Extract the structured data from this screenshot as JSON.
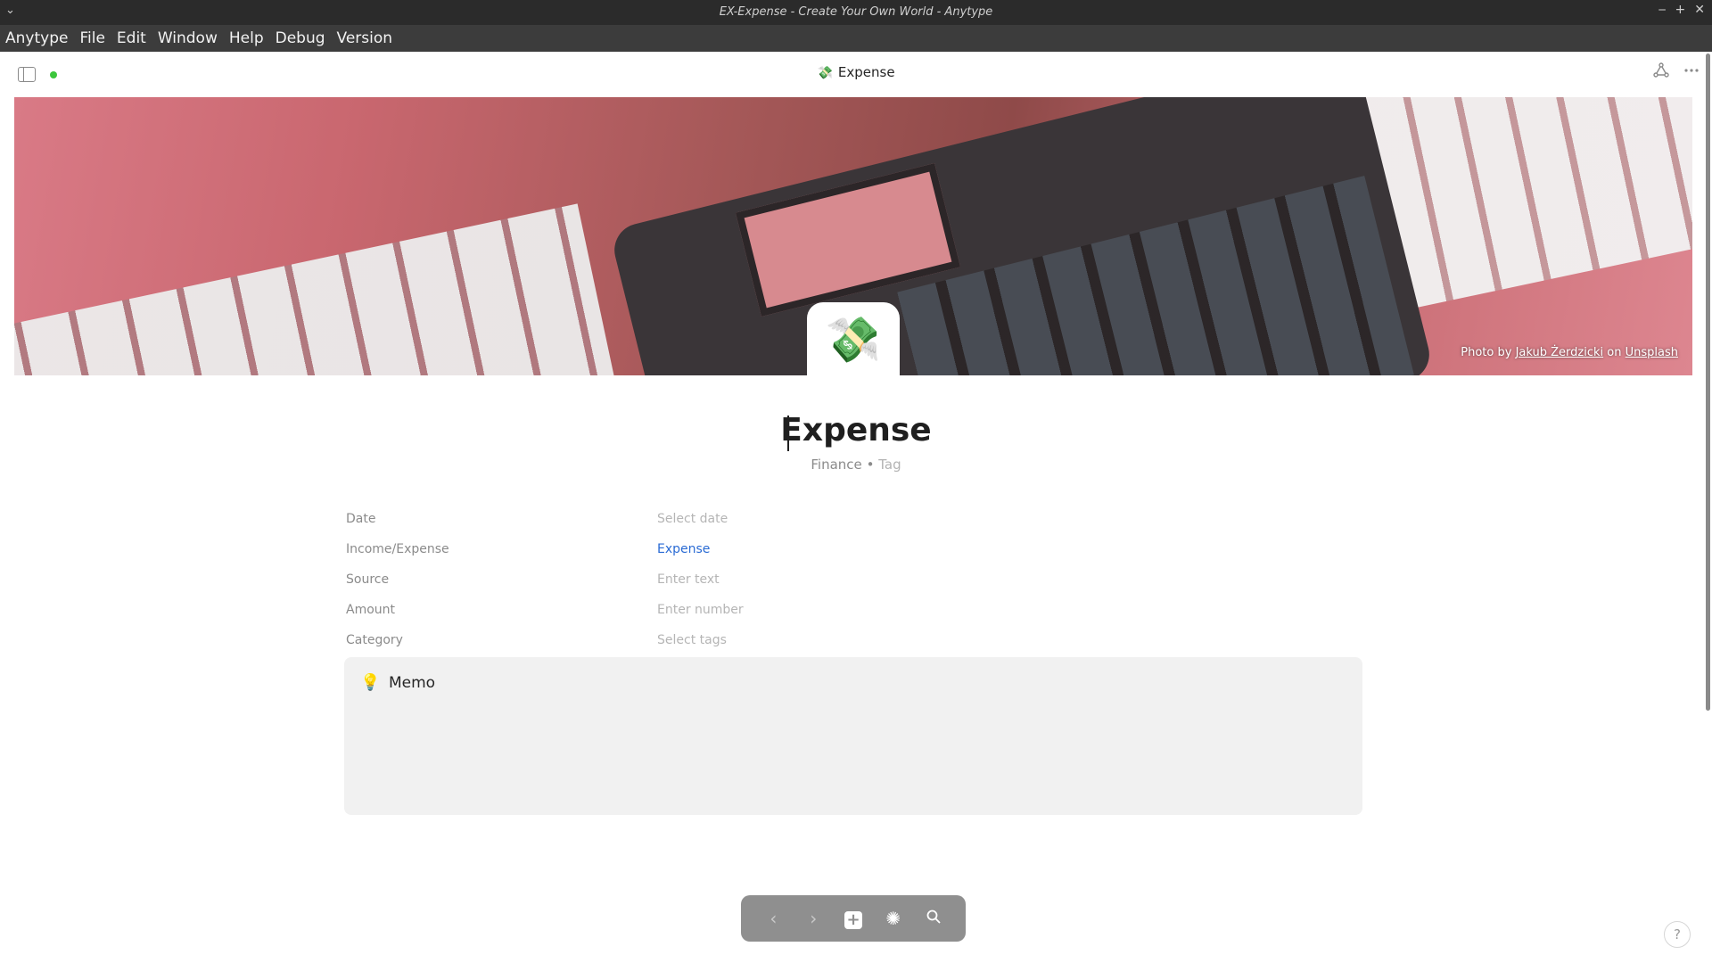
{
  "window": {
    "title": "EX-Expense - Create Your Own World - Anytype",
    "left_glyph": "⌄",
    "controls": [
      "‒",
      "+",
      "✕"
    ]
  },
  "menubar": {
    "items": [
      "Anytype",
      "File",
      "Edit",
      "Window",
      "Help",
      "Debug",
      "Version"
    ]
  },
  "header": {
    "title": "Expense",
    "title_emoji": "💸",
    "sync_color": "#3cc63c",
    "right_icons": [
      "share-graph-icon",
      "more-icon"
    ]
  },
  "cover": {
    "credit_prefix": "Photo by",
    "credit_author": "Jakub Żerdzicki",
    "credit_on": "on",
    "credit_site": "Unsplash"
  },
  "page": {
    "icon": "💸",
    "title": "Expense",
    "featured_type": "Finance",
    "featured_separator": "•",
    "featured_tag_placeholder": "Tag"
  },
  "relations": [
    {
      "name": "Date",
      "value": "Select date",
      "set": false
    },
    {
      "name": "Income/Expense",
      "value": "Expense",
      "set": true
    },
    {
      "name": "Source",
      "value": "Enter text",
      "set": false
    },
    {
      "name": "Amount",
      "value": "Enter number",
      "set": false
    },
    {
      "name": "Category",
      "value": "Select tags",
      "set": false
    }
  ],
  "callout": {
    "icon": "💡",
    "text": "Memo"
  },
  "navbar": {
    "back": "‹",
    "forward": "›",
    "add": "+",
    "graph": "✺",
    "search": "⌕"
  },
  "help": {
    "label": "?"
  },
  "colors": {
    "accent_link": "#2a6bd4",
    "callout_bg": "#f1f1f1",
    "navbar_bg": "#8f8f8f"
  }
}
